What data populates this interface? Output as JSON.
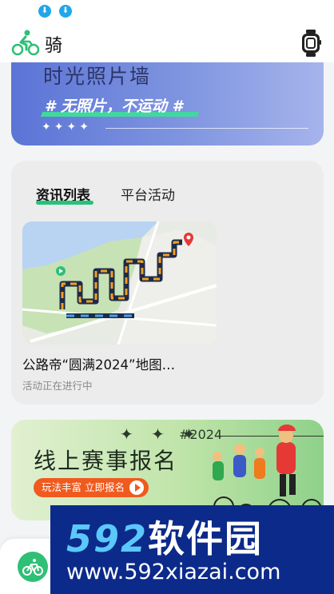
{
  "status_bar": {
    "icons": [
      "download-icon",
      "download-icon"
    ]
  },
  "header": {
    "title": "骑",
    "left_icon": "bicycle-icon",
    "right_icon": "smartwatch-icon"
  },
  "photo_wall_banner": {
    "title": "时光照片墙",
    "slogan": "# 无照片，不运动 #",
    "stars": "✦✦✦✦"
  },
  "news_card": {
    "tabs": [
      {
        "label": "资讯列表",
        "active": true
      },
      {
        "label": "平台活动",
        "active": false
      }
    ],
    "items": [
      {
        "title": "公路帝“圆满2024”地图…",
        "status": "活动正在进行中"
      }
    ]
  },
  "race_banner": {
    "stars": "✦ ✦ ✦",
    "year": "#2024",
    "title": "线上赛事报名",
    "button_label": "玩法丰富 立即报名"
  },
  "bottom_nav": {
    "items": [
      {
        "icon": "bicycle-icon"
      }
    ]
  },
  "watermark": {
    "logo_digits": "592",
    "logo_text": "软件园",
    "url": "www.592xiazai.com"
  },
  "colors": {
    "accent_green": "#23c47a",
    "cta_orange": "#f05a1e",
    "banner_blue": "#5b74d6"
  }
}
